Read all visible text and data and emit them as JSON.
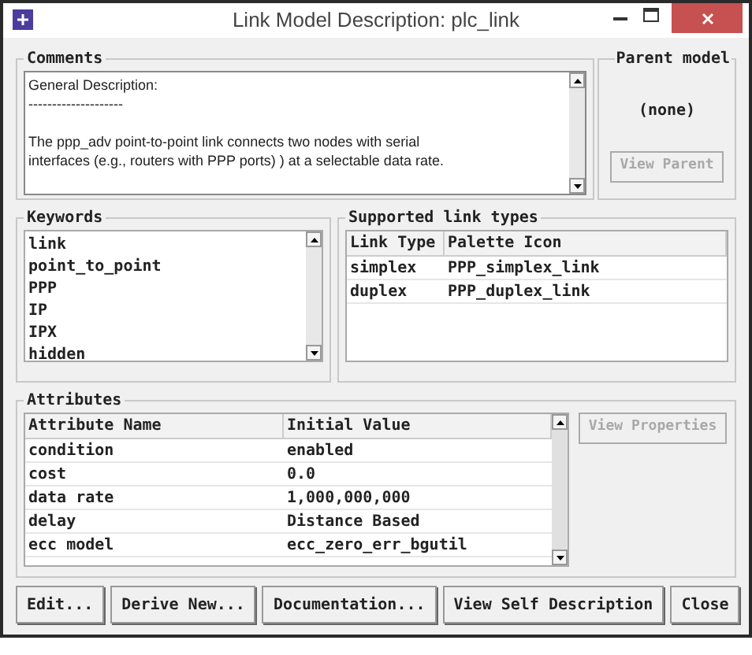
{
  "window": {
    "title": "Link Model Description: plc_link"
  },
  "comments": {
    "title": "Comments",
    "heading": "General Description:",
    "rule": "--------------------",
    "lines": [
      "The ppp_adv point-to-point link connects two nodes with serial",
      "interfaces (e.g., routers with PPP ports) ) at a selectable data rate."
    ]
  },
  "parent_model": {
    "title": "Parent model",
    "value": "(none)",
    "button": {
      "label": "View Parent",
      "disabled": true
    }
  },
  "keywords": {
    "title": "Keywords",
    "items": [
      "link",
      "point_to_point",
      "PPP",
      "IP",
      "IPX",
      "hidden"
    ]
  },
  "link_types": {
    "title": "Supported link types",
    "columns": [
      "Link Type",
      "Palette Icon"
    ],
    "rows": [
      [
        "simplex",
        "PPP_simplex_link"
      ],
      [
        "duplex",
        "PPP_duplex_link"
      ]
    ]
  },
  "attributes": {
    "title": "Attributes",
    "columns": [
      "Attribute Name",
      "Initial Value"
    ],
    "rows": [
      [
        "condition",
        "enabled"
      ],
      [
        "cost",
        "0.0"
      ],
      [
        "data rate",
        "1,000,000,000"
      ],
      [
        "delay",
        "Distance Based"
      ],
      [
        "ecc model",
        "ecc_zero_err_bgutil"
      ]
    ],
    "button": {
      "label": "View Properties",
      "disabled": true
    }
  },
  "buttons": [
    {
      "label": "Edit...",
      "disabled": false
    },
    {
      "label": "Derive New...",
      "disabled": false
    },
    {
      "label": "Documentation...",
      "disabled": false
    },
    {
      "label": "View Self Description",
      "disabled": false
    },
    {
      "label": "Close",
      "disabled": false
    }
  ]
}
